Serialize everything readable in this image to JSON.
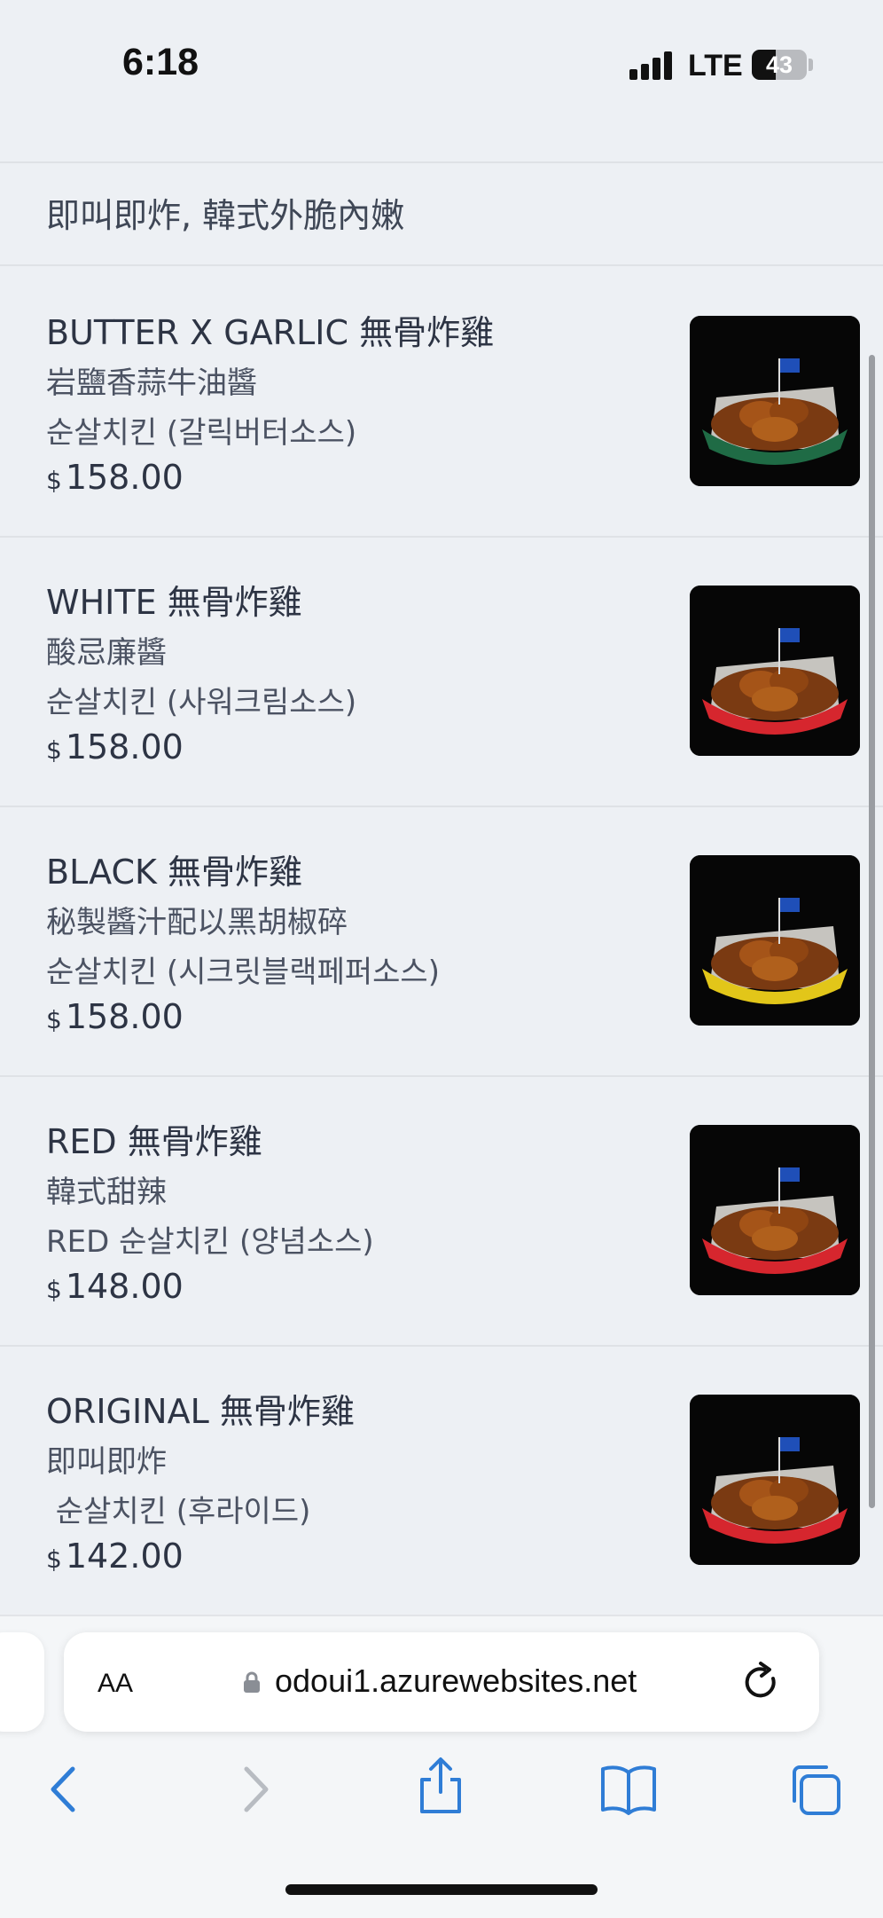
{
  "status_bar": {
    "time": "6:18",
    "network": "LTE",
    "battery": "43",
    "battery_level_percent": 43
  },
  "tagline": "即叫即炸, 韓式外脆內嫩",
  "menu_items": [
    {
      "name": "BUTTER X GARLIC 無骨炸雞",
      "description": "岩鹽香蒜牛油醬",
      "korean": "순살치킨 (갈릭버터소스)",
      "currency": "$",
      "price": "158.00",
      "image": "chicken-image",
      "basket_color": "#1f6b45"
    },
    {
      "name": "WHITE 無骨炸雞",
      "description": "酸忌廉醬",
      "korean": "순살치킨 (사워크림소스)",
      "currency": "$",
      "price": "158.00",
      "image": "chicken-image",
      "basket_color": "#d6262e"
    },
    {
      "name": "BLACK 無骨炸雞",
      "description": "秘製醬汁配以黑胡椒碎",
      "korean": "순살치킨 (시크릿블랙페퍼소스)",
      "currency": "$",
      "price": "158.00",
      "image": "chicken-image",
      "basket_color": "#e2c619"
    },
    {
      "name": "RED 無骨炸雞",
      "description": "韓式甜辣",
      "korean": "RED 순살치킨 (양념소스)",
      "currency": "$",
      "price": "148.00",
      "image": "chicken-image",
      "basket_color": "#d6262e"
    },
    {
      "name": "ORIGINAL 無骨炸雞",
      "description": "即叫即炸",
      "korean": " 순살치킨 (후라이드)",
      "currency": "$",
      "price": "142.00",
      "image": "chicken-image",
      "basket_color": "#d6262e"
    }
  ],
  "browser": {
    "text_size_label": "AA",
    "url": "odoui1.azurewebsites.net",
    "icons": [
      "lock-icon",
      "reload-icon",
      "back-icon",
      "forward-icon",
      "share-icon",
      "bookmarks-icon",
      "tabs-icon"
    ]
  },
  "colors": {
    "accent": "#2f7dd6",
    "disabled": "#b8bcc2",
    "page_bg": "#edf0f4"
  }
}
